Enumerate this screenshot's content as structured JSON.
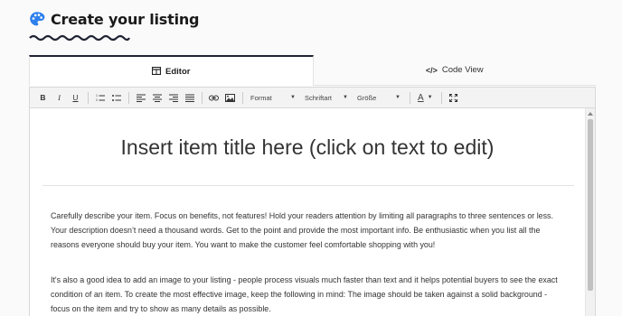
{
  "page": {
    "title": "Create your listing",
    "palette_color": "#2f80ed"
  },
  "tabs": [
    {
      "label": "Editor",
      "icon": "table-icon",
      "active": true
    },
    {
      "label": "Code View",
      "icon": "code-icon",
      "active": false
    }
  ],
  "toolbar": {
    "buttons": [
      "B",
      "I",
      "U"
    ],
    "format_label": "Format",
    "font_label": "Schriftart",
    "size_label": "Größe",
    "color_label": "A"
  },
  "editor": {
    "item_title": "Insert item title here (click on text to edit)",
    "paragraph1": "Carefully describe your item. Focus on benefits, not features! Hold your readers attention by limiting all paragraphs to three sentences or less. Your description doesn’t need a thousand words. Get to the point and provide the most important info. Be enthusiastic when you list all the reasons everyone should buy your item. You want to make the customer feel comfortable shopping with you!",
    "paragraph2": "It's also a good idea to add an image to your listing - people process visuals much faster than text and it helps potential buyers to see the exact condition of an item. To create the most effective image, keep the following in mind: The image should be taken against a solid background - focus on the item and try to show as many details as possible."
  }
}
